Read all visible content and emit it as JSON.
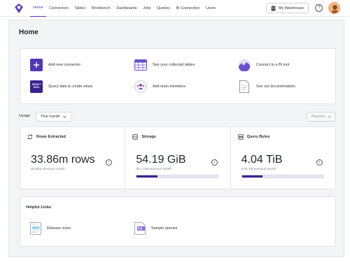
{
  "nav": {
    "items": [
      "Home",
      "Connectors",
      "Tables",
      "Workbench",
      "Dashboards",
      "Jobs",
      "Queries",
      "BI Connection",
      "Users"
    ],
    "active": "Home",
    "warehouse_label": "My Warehouse",
    "help_glyph": "?"
  },
  "page": {
    "title": "Home"
  },
  "quick_actions": [
    {
      "label": "Add new connector",
      "icon": "plus-icon"
    },
    {
      "label": "See your collected tables",
      "icon": "table-icon"
    },
    {
      "label": "Connect to a BI tool",
      "icon": "bi-chart-icon"
    },
    {
      "label": "Query data & create views",
      "icon": "select-data-icon",
      "icon_text": "SELECT DATA"
    },
    {
      "label": "Add team members",
      "icon": "team-icon"
    },
    {
      "label": "See our documentation",
      "icon": "document-icon"
    }
  ],
  "usage": {
    "label": "Usage",
    "period": "This month",
    "reports_label": "Reports"
  },
  "metrics": [
    {
      "title": "Rows Extracted",
      "icon": "sync-icon",
      "value": "33.86m rows",
      "previous": "49.66m previous month"
    },
    {
      "title": "Storage",
      "icon": "storage-icon",
      "value": "54.19 GiB",
      "previous": "53.1 GiB previous month",
      "progress": 0.26
    },
    {
      "title": "Query Bytes",
      "icon": "database-icon",
      "value": "4.04 TiB",
      "previous": "6.84 TiB previous month",
      "progress": 0.25
    }
  ],
  "helpful_links": {
    "title": "Helpful Links",
    "items": [
      {
        "label": "Release notes",
        "icon": "release-notes-icon"
      },
      {
        "label": "Sample queries",
        "icon": "sql-file-icon",
        "icon_text": "SQL"
      }
    ]
  },
  "colors": {
    "accent": "#4f37b6",
    "bar_fill": "#3a238f"
  }
}
